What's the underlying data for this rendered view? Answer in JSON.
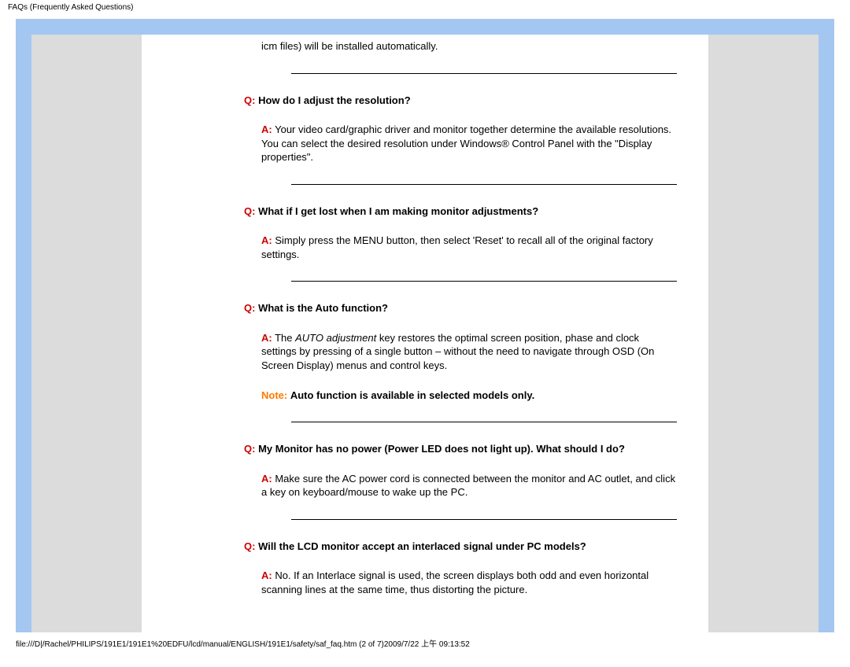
{
  "header_title": "FAQs (Frequently Asked Questions)",
  "fragment_top": "icm files) will be installed automatically.",
  "faqs": [
    {
      "q_label": "Q:",
      "q_text": "How do I adjust the resolution?",
      "a_label": "A:",
      "a_text": "Your video card/graphic driver and monitor together determine the available resolutions. You can select the desired resolution under Windows® Control Panel with the \"Display properties\"."
    },
    {
      "q_label": "Q:",
      "q_text": "What if I get lost when I am making monitor adjustments?",
      "a_label": "A:",
      "a_text": "Simply press the MENU button, then select 'Reset' to recall all of the original factory settings."
    },
    {
      "q_label": "Q:",
      "q_text": "What is the Auto function?",
      "a_label": "A:",
      "a_pre": "The ",
      "a_italic": "AUTO adjustment",
      "a_post": " key restores the optimal screen position, phase and clock settings by pressing of a single button – without the need to navigate through OSD (On Screen Display) menus and control keys.",
      "note_label": "Note:",
      "note_text": "Auto function is available in selected models only."
    },
    {
      "q_label": "Q:",
      "q_text": "My Monitor has no power (Power LED does not light up). What should I do?",
      "a_label": "A:",
      "a_text": "Make sure the AC power cord is connected between the monitor and AC outlet, and click a key on keyboard/mouse to wake up the PC."
    },
    {
      "q_label": "Q:",
      "q_text": "Will the LCD monitor accept an interlaced signal under PC models?",
      "a_label": "A:",
      "a_text": "No. If an Interlace signal is used, the screen displays both odd and even horizontal scanning lines at the same time, thus distorting the picture."
    }
  ],
  "footer_text": "file:///D|/Rachel/PHILIPS/191E1/191E1%20EDFU/lcd/manual/ENGLISH/191E1/safety/saf_faq.htm (2 of 7)2009/7/22 上午 09:13:52"
}
